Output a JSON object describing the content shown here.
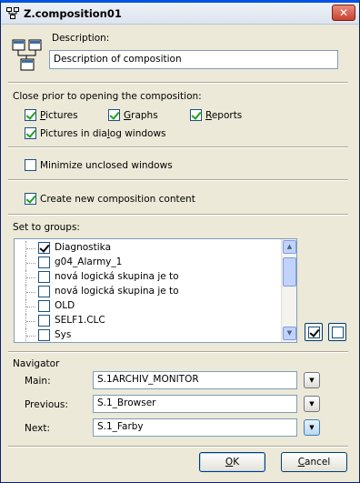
{
  "window": {
    "title": "Z.composition01"
  },
  "description": {
    "label": "Description:",
    "value": "Description of composition"
  },
  "close_section": {
    "heading": "Close prior to opening the composition:",
    "items": [
      {
        "label": "Pictures",
        "accel": "P",
        "rest": "ictures",
        "checked": true
      },
      {
        "label": "Graphs",
        "accel": "G",
        "rest": "raphs",
        "checked": true
      },
      {
        "label": "Reports",
        "accel": "R",
        "rest": "eports",
        "checked": true
      },
      {
        "label": "Pictures in dialog windows",
        "pre": "Pictures in dia",
        "accel": "l",
        "rest": "og windows",
        "checked": true
      }
    ]
  },
  "minimize": {
    "label": "Minimize unclosed windows",
    "checked": false
  },
  "create": {
    "label": "Create new composition content",
    "checked": true
  },
  "groups": {
    "heading": "Set to groups:",
    "items": [
      {
        "label": "Diagnostika",
        "checked": true
      },
      {
        "label": "g04_Alarmy_1",
        "checked": false
      },
      {
        "label": "nová logická skupina je to",
        "checked": false
      },
      {
        "label": "nová logická skupina je to",
        "checked": false
      },
      {
        "label": "OLD",
        "checked": false
      },
      {
        "label": "SELF1.CLC",
        "checked": false
      },
      {
        "label": "Sys",
        "checked": false
      }
    ]
  },
  "navigator": {
    "heading": "Navigator",
    "main_label": "Main:",
    "main_value": "S.1ARCHIV_MONITOR",
    "previous_label": "Previous:",
    "previous_value": "S.1_Browser",
    "next_label": "Next:",
    "next_value": "S.1_Farby"
  },
  "buttons": {
    "ok": "OK",
    "ok_accel": "O",
    "ok_rest": "K",
    "cancel": "Cancel",
    "cancel_accel": "C",
    "cancel_rest": "ancel"
  }
}
